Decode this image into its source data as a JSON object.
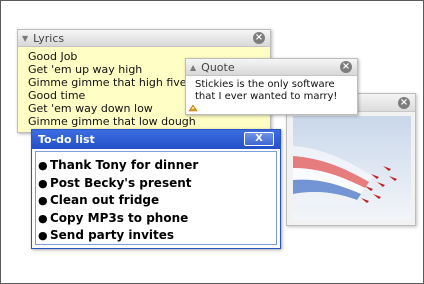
{
  "lyrics": {
    "title": "Lyrics",
    "lines": [
      "Good Job",
      "Get 'em up way high",
      "Gimme gimme that high five",
      "Good time",
      "Get 'em way down low",
      "Gimme gimme that low dough"
    ]
  },
  "quote": {
    "title": "Quote",
    "lines": [
      "Stickies is the only software",
      "that I ever wanted to marry!"
    ]
  },
  "todo": {
    "title": "To-do list",
    "close_label": "X",
    "items": [
      "Thank Tony for dinner",
      "Post Becky's present",
      "Clean out fridge",
      "Copy MP3s to phone",
      "Send party invites"
    ]
  },
  "icons": {
    "collapse": "collapse-triangle-icon",
    "close": "circle-close-icon",
    "grip": "resize-grip-icon"
  },
  "colors": {
    "lyrics_bg": "#fffec4",
    "todo_title": "#2350c8",
    "smoke": [
      "#e03030",
      "#ffffff",
      "#2a60c0"
    ]
  }
}
